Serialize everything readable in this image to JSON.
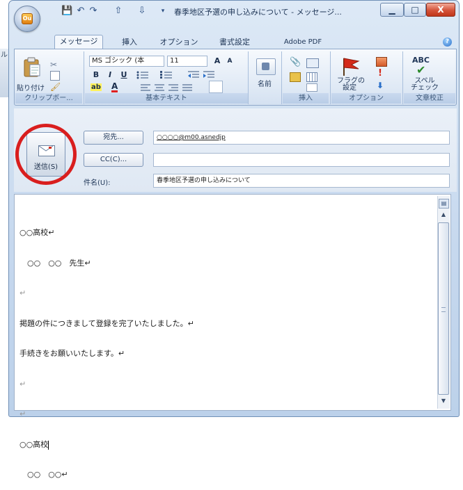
{
  "window": {
    "title": "春季地区予選の申し込みについて - メッセージ...",
    "office_button_glyph": "Ou",
    "qat": [
      "💾",
      "↶",
      "↷",
      "⇧",
      "⇩",
      "▾"
    ],
    "caption": {
      "minimize": "▁",
      "maximize": "□",
      "close": "X"
    },
    "help_icon": "?"
  },
  "background": {
    "strip_text": "ル"
  },
  "tabs": [
    "メッセージ",
    "挿入",
    "オプション",
    "書式設定",
    "Adobe PDF"
  ],
  "ribbon": {
    "clipboard": {
      "paste_label": "貼り付け",
      "group_label": "クリップボー..."
    },
    "basic_text": {
      "font_name": "MS ゴシック (本",
      "font_size": "11",
      "bold": "B",
      "italic": "I",
      "underline": "U",
      "grow_font": "A",
      "shrink_font": "A",
      "highlight": "ab",
      "font_color": "A",
      "group_label": "基本テキスト"
    },
    "names": {
      "label": "名前"
    },
    "include": {
      "group_label": "挿入"
    },
    "options": {
      "flag_label_line1": "フラグの",
      "flag_label_line2": "設定",
      "group_label": "オプション"
    },
    "proofing": {
      "abc": "ABC",
      "spell_line1": "スペル",
      "spell_line2": "チェック",
      "group_label": "文章校正"
    }
  },
  "compose": {
    "send_label": "送信(S)",
    "to_button": "宛先...",
    "cc_button": "CC(C)...",
    "subject_label": "件名(U):",
    "to_value": "○○○○@m00.asnedjp",
    "cc_value": "",
    "subject_value": "春季地区予選の申し込みについて"
  },
  "body_lines": [
    "○○高校↵",
    "　○○　○○　先生↵",
    "↵",
    "掲題の件につきまして登録を完了いたしました。↵",
    "手続きをお願いいたします。↵",
    "↵",
    "↵",
    "○○高校",
    "　○○　○○↵"
  ],
  "colors": {
    "highlight_circle": "#d91e1e",
    "flag": "#d42a1a"
  }
}
